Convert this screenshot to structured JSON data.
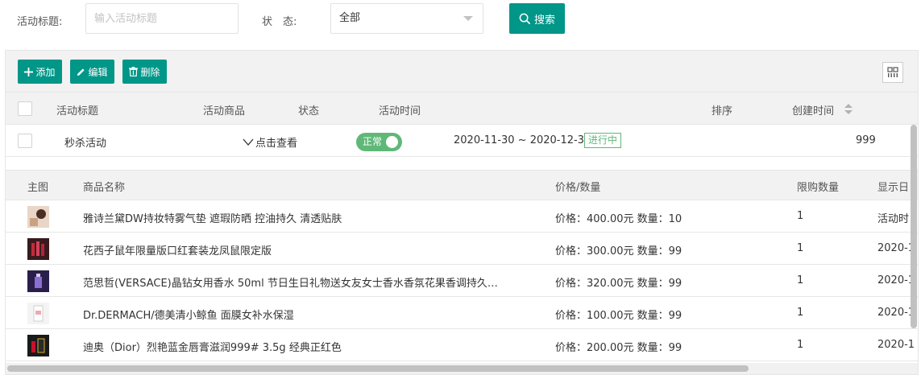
{
  "search": {
    "title_label": "活动标题:",
    "title_placeholder": "输入活动标题",
    "status_label": "状　态:",
    "status_value": "全部",
    "search_button": "搜索"
  },
  "toolbar": {
    "add": "添加",
    "edit": "编辑",
    "delete": "删除"
  },
  "columns": {
    "title": "活动标题",
    "goods": "活动商品",
    "status": "状态",
    "time": "活动时间",
    "sort": "排序",
    "created": "创建时间"
  },
  "activity": {
    "title": "秒杀活动",
    "goods_link": "点击查看",
    "status_toggle": "正常",
    "time_range": "2020-11-30 ~ 2020-12-30",
    "progress_badge": "进行中",
    "sort": "999"
  },
  "sub_columns": {
    "image": "主图",
    "name": "商品名称",
    "price_qty": "价格/数量",
    "limit": "限购数量",
    "display": "显示日"
  },
  "products": [
    {
      "name": "雅诗兰黛DW持妆特雾气垫 遮瑕防晒 控油持久 清透贴肤",
      "price_qty": "价格：400.00元 数量：10",
      "limit": "1",
      "display": "活动时"
    },
    {
      "name": "花西子鼠年限量版口红套装龙凤鼠限定版",
      "price_qty": "价格：300.00元 数量：99",
      "limit": "1",
      "display": "2020-1"
    },
    {
      "name": "范思哲(VERSACE)晶钻女用香水 50ml 节日生日礼物送女友女士香水香氛花果香调持久…",
      "price_qty": "价格：320.00元 数量：99",
      "limit": "1",
      "display": "2020-1"
    },
    {
      "name": "Dr.DERMACH/德美清小鲸鱼 面膜女补水保湿",
      "price_qty": "价格：100.00元 数量：99",
      "limit": "1",
      "display": "2020-1"
    },
    {
      "name": "迪奥（Dior）烈艳蓝金唇膏滋润999# 3.5g 经典正红色",
      "price_qty": "价格：200.00元 数量：99",
      "limit": "1",
      "display": "2020-1"
    }
  ],
  "colors": {
    "primary": "#009688",
    "toggle_on": "#5fb878",
    "header_bg": "#f2f2f2"
  }
}
